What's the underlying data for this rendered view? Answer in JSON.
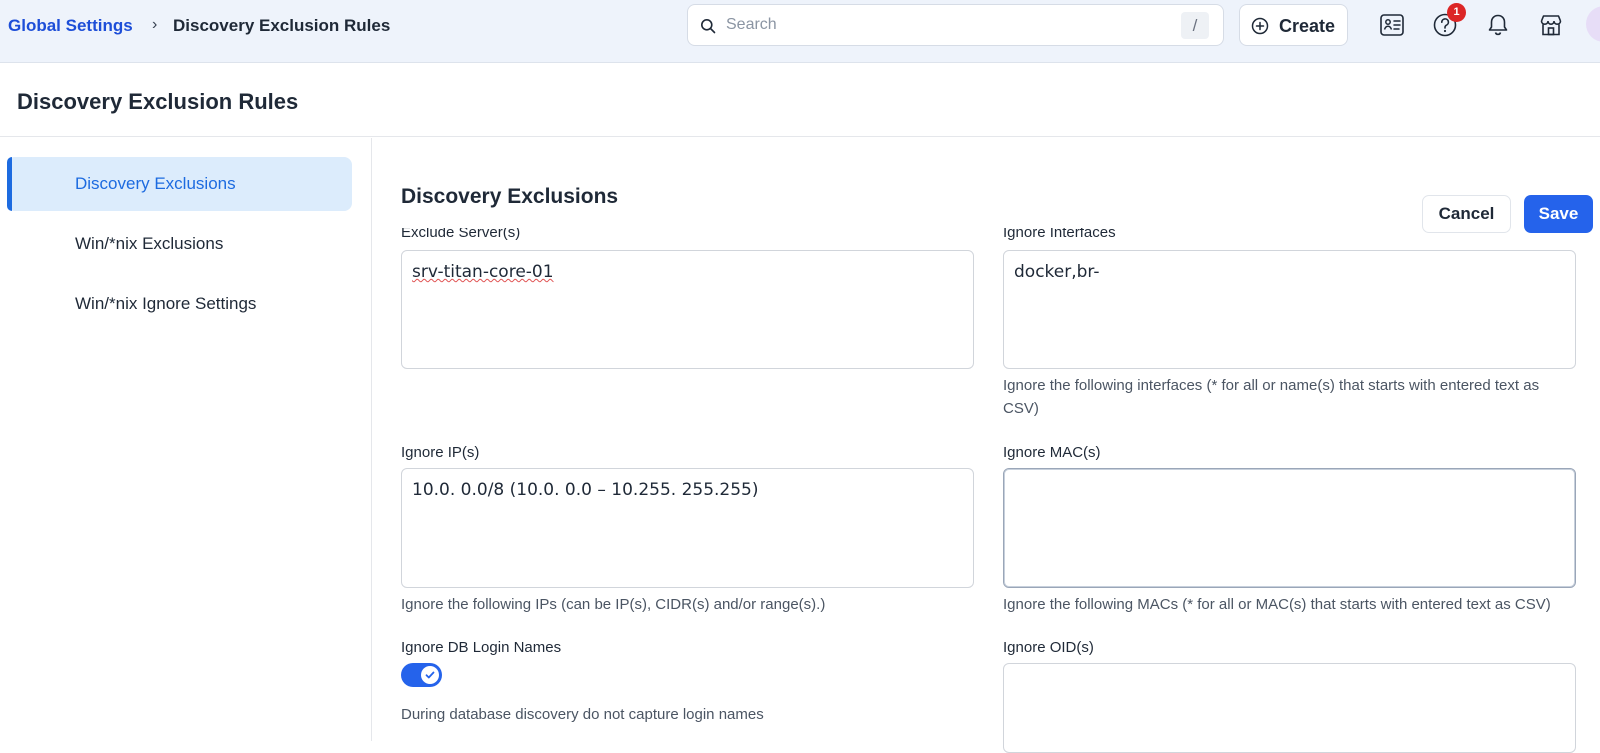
{
  "breadcrumb": {
    "root": "Global Settings",
    "separator": "›",
    "current": "Discovery Exclusion Rules"
  },
  "search": {
    "placeholder": "Search",
    "shortcut": "/"
  },
  "header_actions": {
    "create_label": "Create",
    "help_badge_count": "1",
    "icons": [
      "tasks-icon",
      "help-icon",
      "bell-icon",
      "store-icon",
      "avatar"
    ]
  },
  "page": {
    "title": "Discovery Exclusion Rules"
  },
  "sidebar": {
    "items": [
      {
        "label": "Discovery Exclusions",
        "active": true
      },
      {
        "label": "Win/*nix Exclusions",
        "active": false
      },
      {
        "label": "Win/*nix Ignore Settings",
        "active": false
      }
    ]
  },
  "main": {
    "section_title": "Discovery Exclusions",
    "cancel_label": "Cancel",
    "save_label": "Save",
    "exclude_servers": {
      "label": "Exclude Server(s)",
      "value": "srv-titan-core-01"
    },
    "ignore_interfaces": {
      "label": "Ignore Interfaces",
      "value": "docker,br-",
      "help": "Ignore the following interfaces (* for all or name(s) that starts with entered text as CSV)"
    },
    "ignore_ips": {
      "label": "Ignore IP(s)",
      "value": "10.0. 0.0/8 (10.0. 0.0 – 10.255. 255.255)",
      "help": "Ignore the following IPs (can be IP(s), CIDR(s) and/or range(s).)"
    },
    "ignore_macs": {
      "label": "Ignore MAC(s)",
      "value": "",
      "help": "Ignore the following MACs (* for all or MAC(s) that starts with entered text as CSV)"
    },
    "ignore_db_login": {
      "label": "Ignore DB Login Names",
      "enabled": true,
      "help": "During database discovery do not capture login names"
    },
    "ignore_oids": {
      "label": "Ignore OID(s)",
      "value": ""
    }
  },
  "colors": {
    "accent": "#2563eb",
    "active_nav_bg": "#dcecfc",
    "badge": "#dc2626",
    "topbar_bg": "#eef3fb"
  }
}
